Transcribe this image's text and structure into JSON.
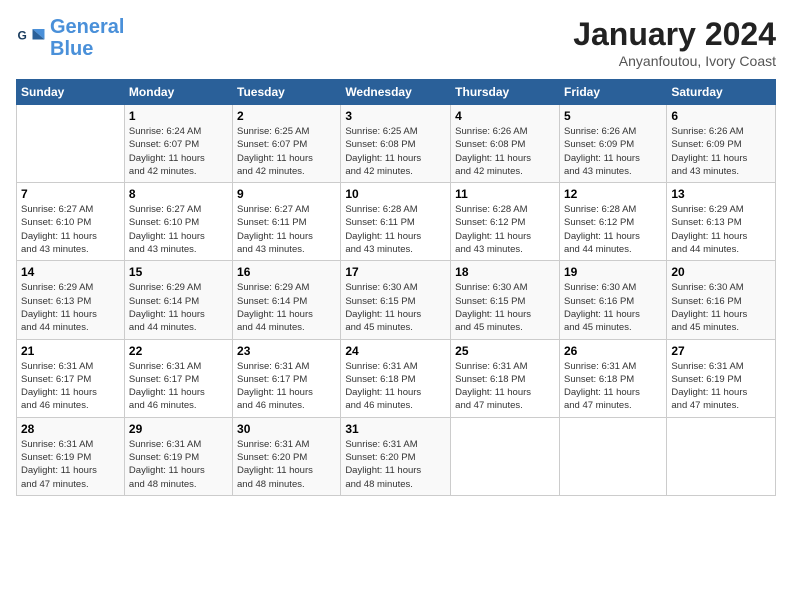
{
  "header": {
    "logo_line1": "General",
    "logo_line2": "Blue",
    "title": "January 2024",
    "subtitle": "Anyanfoutou, Ivory Coast"
  },
  "days_of_week": [
    "Sunday",
    "Monday",
    "Tuesday",
    "Wednesday",
    "Thursday",
    "Friday",
    "Saturday"
  ],
  "weeks": [
    [
      {
        "day": "",
        "sunrise": "",
        "sunset": "",
        "daylight": ""
      },
      {
        "day": "1",
        "sunrise": "Sunrise: 6:24 AM",
        "sunset": "Sunset: 6:07 PM",
        "daylight": "Daylight: 11 hours and 42 minutes."
      },
      {
        "day": "2",
        "sunrise": "Sunrise: 6:25 AM",
        "sunset": "Sunset: 6:07 PM",
        "daylight": "Daylight: 11 hours and 42 minutes."
      },
      {
        "day": "3",
        "sunrise": "Sunrise: 6:25 AM",
        "sunset": "Sunset: 6:08 PM",
        "daylight": "Daylight: 11 hours and 42 minutes."
      },
      {
        "day": "4",
        "sunrise": "Sunrise: 6:26 AM",
        "sunset": "Sunset: 6:08 PM",
        "daylight": "Daylight: 11 hours and 42 minutes."
      },
      {
        "day": "5",
        "sunrise": "Sunrise: 6:26 AM",
        "sunset": "Sunset: 6:09 PM",
        "daylight": "Daylight: 11 hours and 43 minutes."
      },
      {
        "day": "6",
        "sunrise": "Sunrise: 6:26 AM",
        "sunset": "Sunset: 6:09 PM",
        "daylight": "Daylight: 11 hours and 43 minutes."
      }
    ],
    [
      {
        "day": "7",
        "sunrise": "Sunrise: 6:27 AM",
        "sunset": "Sunset: 6:10 PM",
        "daylight": "Daylight: 11 hours and 43 minutes."
      },
      {
        "day": "8",
        "sunrise": "Sunrise: 6:27 AM",
        "sunset": "Sunset: 6:10 PM",
        "daylight": "Daylight: 11 hours and 43 minutes."
      },
      {
        "day": "9",
        "sunrise": "Sunrise: 6:27 AM",
        "sunset": "Sunset: 6:11 PM",
        "daylight": "Daylight: 11 hours and 43 minutes."
      },
      {
        "day": "10",
        "sunrise": "Sunrise: 6:28 AM",
        "sunset": "Sunset: 6:11 PM",
        "daylight": "Daylight: 11 hours and 43 minutes."
      },
      {
        "day": "11",
        "sunrise": "Sunrise: 6:28 AM",
        "sunset": "Sunset: 6:12 PM",
        "daylight": "Daylight: 11 hours and 43 minutes."
      },
      {
        "day": "12",
        "sunrise": "Sunrise: 6:28 AM",
        "sunset": "Sunset: 6:12 PM",
        "daylight": "Daylight: 11 hours and 44 minutes."
      },
      {
        "day": "13",
        "sunrise": "Sunrise: 6:29 AM",
        "sunset": "Sunset: 6:13 PM",
        "daylight": "Daylight: 11 hours and 44 minutes."
      }
    ],
    [
      {
        "day": "14",
        "sunrise": "Sunrise: 6:29 AM",
        "sunset": "Sunset: 6:13 PM",
        "daylight": "Daylight: 11 hours and 44 minutes."
      },
      {
        "day": "15",
        "sunrise": "Sunrise: 6:29 AM",
        "sunset": "Sunset: 6:14 PM",
        "daylight": "Daylight: 11 hours and 44 minutes."
      },
      {
        "day": "16",
        "sunrise": "Sunrise: 6:29 AM",
        "sunset": "Sunset: 6:14 PM",
        "daylight": "Daylight: 11 hours and 44 minutes."
      },
      {
        "day": "17",
        "sunrise": "Sunrise: 6:30 AM",
        "sunset": "Sunset: 6:15 PM",
        "daylight": "Daylight: 11 hours and 45 minutes."
      },
      {
        "day": "18",
        "sunrise": "Sunrise: 6:30 AM",
        "sunset": "Sunset: 6:15 PM",
        "daylight": "Daylight: 11 hours and 45 minutes."
      },
      {
        "day": "19",
        "sunrise": "Sunrise: 6:30 AM",
        "sunset": "Sunset: 6:16 PM",
        "daylight": "Daylight: 11 hours and 45 minutes."
      },
      {
        "day": "20",
        "sunrise": "Sunrise: 6:30 AM",
        "sunset": "Sunset: 6:16 PM",
        "daylight": "Daylight: 11 hours and 45 minutes."
      }
    ],
    [
      {
        "day": "21",
        "sunrise": "Sunrise: 6:31 AM",
        "sunset": "Sunset: 6:17 PM",
        "daylight": "Daylight: 11 hours and 46 minutes."
      },
      {
        "day": "22",
        "sunrise": "Sunrise: 6:31 AM",
        "sunset": "Sunset: 6:17 PM",
        "daylight": "Daylight: 11 hours and 46 minutes."
      },
      {
        "day": "23",
        "sunrise": "Sunrise: 6:31 AM",
        "sunset": "Sunset: 6:17 PM",
        "daylight": "Daylight: 11 hours and 46 minutes."
      },
      {
        "day": "24",
        "sunrise": "Sunrise: 6:31 AM",
        "sunset": "Sunset: 6:18 PM",
        "daylight": "Daylight: 11 hours and 46 minutes."
      },
      {
        "day": "25",
        "sunrise": "Sunrise: 6:31 AM",
        "sunset": "Sunset: 6:18 PM",
        "daylight": "Daylight: 11 hours and 47 minutes."
      },
      {
        "day": "26",
        "sunrise": "Sunrise: 6:31 AM",
        "sunset": "Sunset: 6:18 PM",
        "daylight": "Daylight: 11 hours and 47 minutes."
      },
      {
        "day": "27",
        "sunrise": "Sunrise: 6:31 AM",
        "sunset": "Sunset: 6:19 PM",
        "daylight": "Daylight: 11 hours and 47 minutes."
      }
    ],
    [
      {
        "day": "28",
        "sunrise": "Sunrise: 6:31 AM",
        "sunset": "Sunset: 6:19 PM",
        "daylight": "Daylight: 11 hours and 47 minutes."
      },
      {
        "day": "29",
        "sunrise": "Sunrise: 6:31 AM",
        "sunset": "Sunset: 6:19 PM",
        "daylight": "Daylight: 11 hours and 48 minutes."
      },
      {
        "day": "30",
        "sunrise": "Sunrise: 6:31 AM",
        "sunset": "Sunset: 6:20 PM",
        "daylight": "Daylight: 11 hours and 48 minutes."
      },
      {
        "day": "31",
        "sunrise": "Sunrise: 6:31 AM",
        "sunset": "Sunset: 6:20 PM",
        "daylight": "Daylight: 11 hours and 48 minutes."
      },
      {
        "day": "",
        "sunrise": "",
        "sunset": "",
        "daylight": ""
      },
      {
        "day": "",
        "sunrise": "",
        "sunset": "",
        "daylight": ""
      },
      {
        "day": "",
        "sunrise": "",
        "sunset": "",
        "daylight": ""
      }
    ]
  ]
}
